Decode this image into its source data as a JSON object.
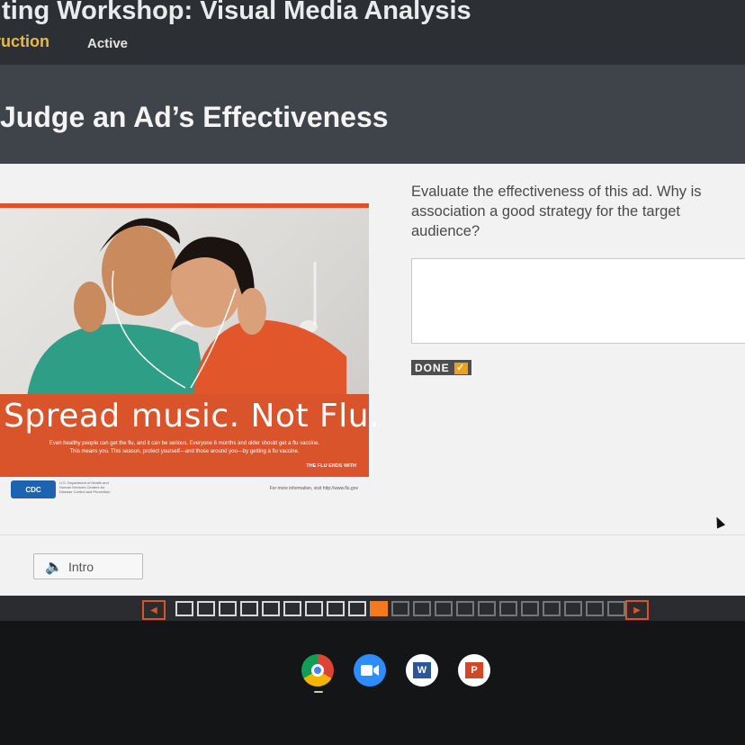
{
  "header": {
    "course_title": "iting Workshop: Visual Media Analysis",
    "tab_instruction": "ruction",
    "tab_active": "Active"
  },
  "lesson": {
    "title": "Judge an Ad’s Effectiveness"
  },
  "ad": {
    "slogan": "Spread music. Not Flu.",
    "body_line1": "Even healthy people can get the flu, and it can be serious. Everyone 6 months and older should get a flu vaccine.",
    "body_line2": "This means you. This season, protect yourself—and those around you—by getting a flu vaccine.",
    "tagline": "THE FLU ENDS WITH",
    "org_logo": "CDC",
    "org_text": "U.S. Department of Health and Human Services Centers for Disease Control and Prevention",
    "url_text": "For more information, visit http://www.flu.gov",
    "banner_color": "#d9532b"
  },
  "question": {
    "prompt": "Evaluate the effectiveness of this ad. Why is association a good strategy for the target audience?",
    "answer_value": "",
    "done_label": "DONE"
  },
  "intro": {
    "label": "Intro"
  },
  "pager": {
    "total": 22,
    "current": 10,
    "accent_color": "#f47a20"
  },
  "taskbar": {
    "apps": [
      "chrome-icon",
      "zoom-icon",
      "word-icon",
      "powerpoint-icon"
    ],
    "word_glyph": "W",
    "ppt_glyph": "P"
  }
}
